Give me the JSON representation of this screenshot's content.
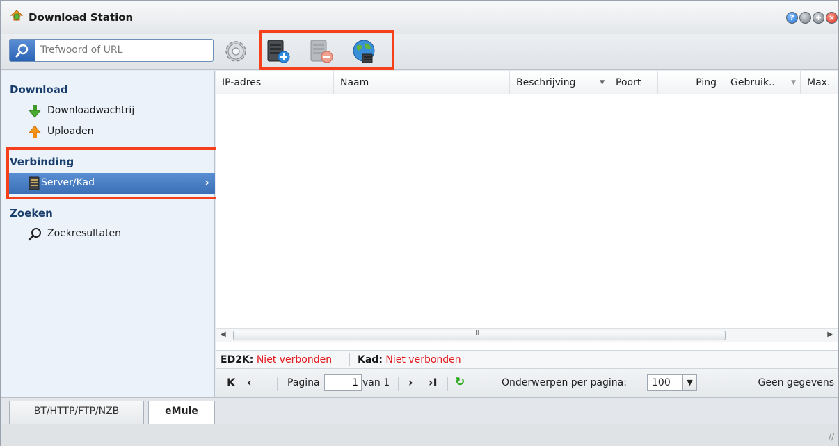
{
  "window": {
    "title": "Download Station",
    "buttons": [
      "help",
      "minimize",
      "maximize",
      "close"
    ]
  },
  "toolbar": {
    "search_placeholder": "Trefwoord of URL",
    "icons": [
      "gear-icon",
      "add-server-icon",
      "remove-server-icon",
      "globe-icon"
    ]
  },
  "sidebar": {
    "sections": [
      {
        "label": "Download",
        "items": [
          {
            "label": "Downloadwachtrij",
            "icon": "download-arrow-icon"
          },
          {
            "label": "Uploaden",
            "icon": "upload-arrow-icon"
          }
        ]
      },
      {
        "label": "Verbinding",
        "items": [
          {
            "label": "Server/Kad",
            "icon": "server-icon",
            "selected": true
          }
        ]
      },
      {
        "label": "Zoeken",
        "items": [
          {
            "label": "Zoekresultaten",
            "icon": "search-icon"
          }
        ]
      }
    ]
  },
  "grid": {
    "columns": [
      "IP-adres",
      "Naam",
      "Beschrijving",
      "Poort",
      "Ping",
      "Gebruik..",
      "Max."
    ],
    "rows": []
  },
  "status": {
    "ed2k_label": "ED2K:",
    "ed2k_value": "Niet verbonden",
    "kad_label": "Kad:",
    "kad_value": "Niet verbonden"
  },
  "pager": {
    "page_label": "Pagina",
    "page_value": "1",
    "of_label": "van 1",
    "per_page_label": "Onderwerpen per pagina:",
    "per_page_value": "100",
    "empty_text": "Geen gegevens"
  },
  "tabs": [
    {
      "label": "BT/HTTP/FTP/NZB",
      "active": false
    },
    {
      "label": "eMule",
      "active": true
    }
  ],
  "colors": {
    "highlight": "#f5401b",
    "selected_row": "#3a6fb6",
    "status_error": "#e3191d",
    "refresh": "#2eaa1f"
  }
}
